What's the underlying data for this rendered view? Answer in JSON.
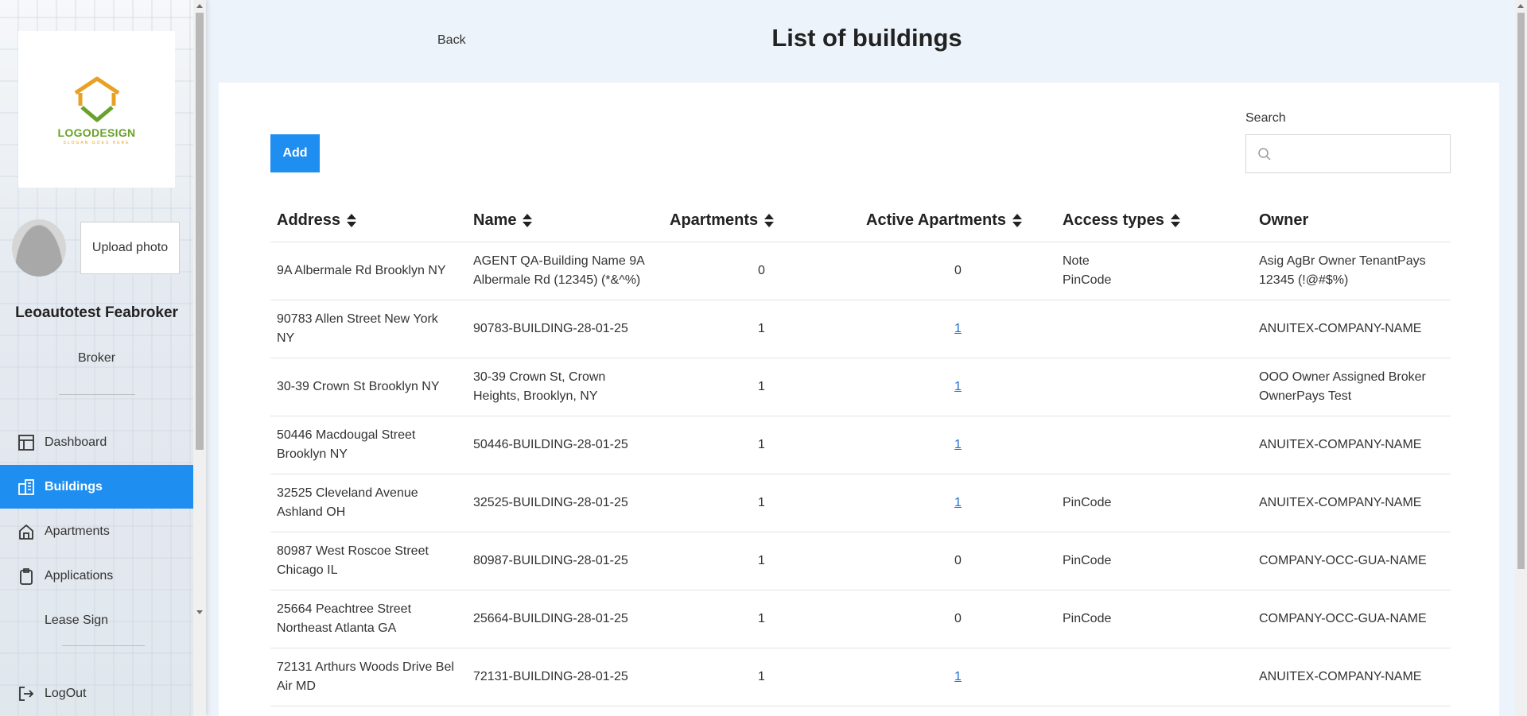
{
  "sidebar": {
    "logo": {
      "text": "LOGODESIGN",
      "tagline": "SLOGAN GOES HERE"
    },
    "upload_photo": "Upload photo",
    "user": {
      "name": "Leoautotest Feabroker",
      "role": "Broker"
    },
    "nav": [
      {
        "label": "Dashboard",
        "icon": "dashboard-icon",
        "active": false
      },
      {
        "label": "Buildings",
        "icon": "buildings-icon",
        "active": true
      },
      {
        "label": "Apartments",
        "icon": "home-icon",
        "active": false
      },
      {
        "label": "Applications",
        "icon": "clipboard-icon",
        "active": false
      },
      {
        "label": "Lease Sign",
        "icon": "",
        "active": false
      }
    ],
    "logout": "LogOut"
  },
  "header": {
    "back": "Back",
    "title": "List of buildings"
  },
  "toolbar": {
    "add": "Add",
    "search_label": "Search",
    "search_placeholder": ""
  },
  "table": {
    "columns": [
      "Address",
      "Name",
      "Apartments",
      "Active Apartments",
      "Access types",
      "Owner"
    ],
    "rows": [
      {
        "address": "9A Albermale Rd Brooklyn NY",
        "name": "AGENT QA-Building Name 9A Albermale Rd (12345) (*&^%)",
        "apartments": "0",
        "active": "0",
        "active_link": false,
        "access": [
          "Note",
          "PinCode"
        ],
        "owner": "Asig AgBr Owner TenantPays 12345 (!@#$%)"
      },
      {
        "address": "90783 Allen Street New York NY",
        "name": "90783-BUILDING-28-01-25",
        "apartments": "1",
        "active": "1",
        "active_link": true,
        "access": [],
        "owner": "ANUITEX-COMPANY-NAME"
      },
      {
        "address": "30-39 Crown St Brooklyn NY",
        "name": "30-39 Crown St, Crown Heights, Brooklyn, NY",
        "apartments": "1",
        "active": "1",
        "active_link": true,
        "access": [],
        "owner": "OOO Owner Assigned Broker OwnerPays Test"
      },
      {
        "address": "50446 Macdougal Street Brooklyn NY",
        "name": "50446-BUILDING-28-01-25",
        "apartments": "1",
        "active": "1",
        "active_link": true,
        "access": [],
        "owner": "ANUITEX-COMPANY-NAME"
      },
      {
        "address": "32525 Cleveland Avenue Ashland OH",
        "name": "32525-BUILDING-28-01-25",
        "apartments": "1",
        "active": "1",
        "active_link": true,
        "access": [
          "PinCode"
        ],
        "owner": "ANUITEX-COMPANY-NAME"
      },
      {
        "address": "80987 West Roscoe Street Chicago IL",
        "name": "80987-BUILDING-28-01-25",
        "apartments": "1",
        "active": "0",
        "active_link": false,
        "access": [
          "PinCode"
        ],
        "owner": "COMPANY-OCC-GUA-NAME"
      },
      {
        "address": "25664 Peachtree Street Northeast Atlanta GA",
        "name": "25664-BUILDING-28-01-25",
        "apartments": "1",
        "active": "0",
        "active_link": false,
        "access": [
          "PinCode"
        ],
        "owner": "COMPANY-OCC-GUA-NAME"
      },
      {
        "address": "72131 Arthurs Woods Drive Bel Air MD",
        "name": "72131-BUILDING-28-01-25",
        "apartments": "1",
        "active": "1",
        "active_link": true,
        "access": [],
        "owner": "ANUITEX-COMPANY-NAME"
      }
    ]
  },
  "colors": {
    "accent": "#1f8ef1",
    "link": "#1f6fd1",
    "page_bg": "#edf3fa"
  }
}
